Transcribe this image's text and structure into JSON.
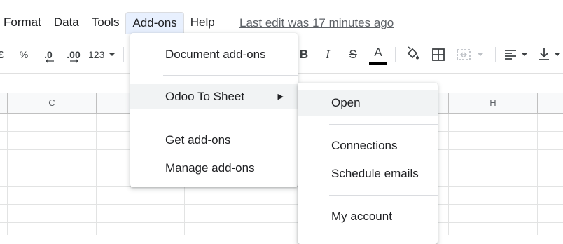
{
  "menubar": {
    "items": [
      "Format",
      "Data",
      "Tools",
      "Add-ons",
      "Help"
    ],
    "last_edit": "Last edit was 17 minutes ago"
  },
  "toolbar": {
    "percent": "%",
    "decimal_decrease": ".0",
    "decimal_increase": ".00",
    "number_format": "123",
    "bold": "B",
    "italic": "I",
    "strike": "S",
    "text_color": "A",
    "text_color_value": "#000000"
  },
  "columns": [
    "C",
    "H"
  ],
  "addons_menu": {
    "items": [
      "Document add-ons",
      "Odoo To Sheet",
      "Get add-ons",
      "Manage add-ons"
    ],
    "submenu_arrow": "▶"
  },
  "odoo_submenu": {
    "items": [
      "Open",
      "Connections",
      "Schedule emails",
      "My account"
    ]
  },
  "colors": {
    "active_menu_bg": "#e8f0fe",
    "hover_bg": "#f1f3f4"
  }
}
